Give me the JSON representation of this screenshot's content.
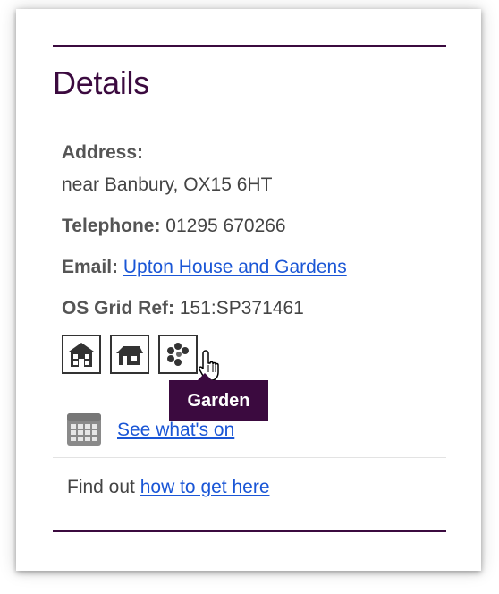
{
  "details": {
    "title": "Details",
    "address_label": "Address:",
    "address_value": "near Banbury, OX15 6HT",
    "telephone_label": "Telephone:",
    "telephone_value": "01295 670266",
    "email_label": "Email:",
    "email_link": "Upton House and Gardens",
    "os_grid_label": "OS Grid Ref:",
    "os_grid_value": "151:SP371461"
  },
  "facility_icons": [
    "house-icon",
    "building-icon",
    "garden-icon"
  ],
  "tooltip": "Garden",
  "events": {
    "link": "See what's on",
    "icon": "calendar-icon"
  },
  "directions": {
    "prefix": "Find out",
    "link": "how to get here"
  },
  "colors": {
    "accent": "#3b0a3f",
    "link": "#1a56d6"
  }
}
